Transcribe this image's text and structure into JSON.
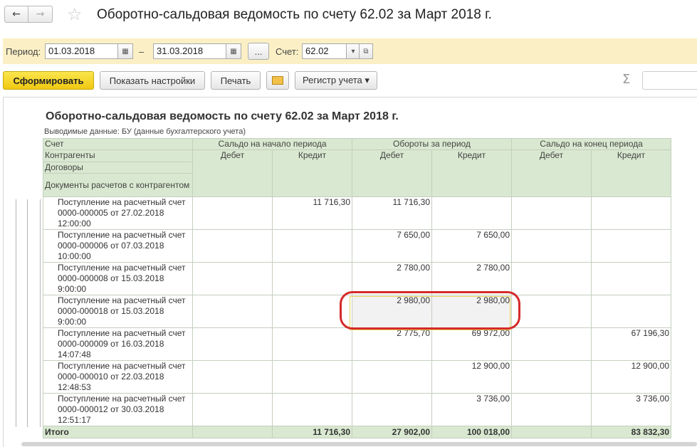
{
  "window": {
    "title": "Оборотно-сальдовая ведомость по счету 62.02 за Март 2018 г."
  },
  "period_bar": {
    "period_label": "Период:",
    "date_from": "01.03.2018",
    "dash": "–",
    "date_to": "31.03.2018",
    "dots_label": "...",
    "account_label": "Счет:",
    "account_value": "62.02"
  },
  "toolbar": {
    "generate_label": "Сформировать",
    "settings_label": "Показать настройки",
    "print_label": "Печать",
    "register_label": "Регистр учета ▾",
    "sigma": "Σ"
  },
  "report": {
    "title": "Оборотно-сальдовая ведомость по счету 62.02 за Март 2018 г.",
    "subtitle": "Выводимые данные:  БУ (данные бухгалтерского учета)",
    "header": {
      "account": "Счет",
      "counterparties": "Контрагенты",
      "contracts": "Договоры",
      "documents": "Документы расчетов с контрагентом",
      "opening": "Сальдо на начало периода",
      "turnover": "Обороты за период",
      "closing": "Сальдо на конец периода",
      "debit": "Дебет",
      "credit": "Кредит"
    },
    "rows": [
      {
        "doc": "Поступление на расчетный счет 0000-000005 от 27.02.2018 12:00:00",
        "open_debit": "",
        "open_credit": "11 716,30",
        "turn_debit": "11 716,30",
        "turn_credit": "",
        "close_debit": "",
        "close_credit": ""
      },
      {
        "doc": "Поступление на расчетный счет 0000-000006 от 07.03.2018 10:00:00",
        "open_debit": "",
        "open_credit": "",
        "turn_debit": "7 650,00",
        "turn_credit": "7 650,00",
        "close_debit": "",
        "close_credit": ""
      },
      {
        "doc": "Поступление на расчетный счет 0000-000008 от 15.03.2018 9:00:00",
        "open_debit": "",
        "open_credit": "",
        "turn_debit": "2 780,00",
        "turn_credit": "2 780,00",
        "close_debit": "",
        "close_credit": ""
      },
      {
        "doc": "Поступление на расчетный счет 0000-000018 от 15.03.2018 9:00:00",
        "open_debit": "",
        "open_credit": "",
        "turn_debit": "2 980,00",
        "turn_credit": "2 980,00",
        "close_debit": "",
        "close_credit": ""
      },
      {
        "doc": "Поступление на расчетный счет 0000-000009 от 16.03.2018 14:07:48",
        "open_debit": "",
        "open_credit": "",
        "turn_debit": "2 775,70",
        "turn_credit": "69 972,00",
        "close_debit": "",
        "close_credit": "67 196,30"
      },
      {
        "doc": "Поступление на расчетный счет 0000-000010 от 22.03.2018 12:48:53",
        "open_debit": "",
        "open_credit": "",
        "turn_debit": "",
        "turn_credit": "12 900,00",
        "close_debit": "",
        "close_credit": "12 900,00"
      },
      {
        "doc": "Поступление на расчетный счет 0000-000012 от 30.03.2018 12:51:17",
        "open_debit": "",
        "open_credit": "",
        "turn_debit": "",
        "turn_credit": "3 736,00",
        "close_debit": "",
        "close_credit": "3 736,00"
      }
    ],
    "total": {
      "label": "Итого",
      "open_debit": "",
      "open_credit": "11 716,30",
      "turn_debit": "27 902,00",
      "turn_credit": "100 018,00",
      "close_debit": "",
      "close_credit": "83 832,30"
    }
  }
}
